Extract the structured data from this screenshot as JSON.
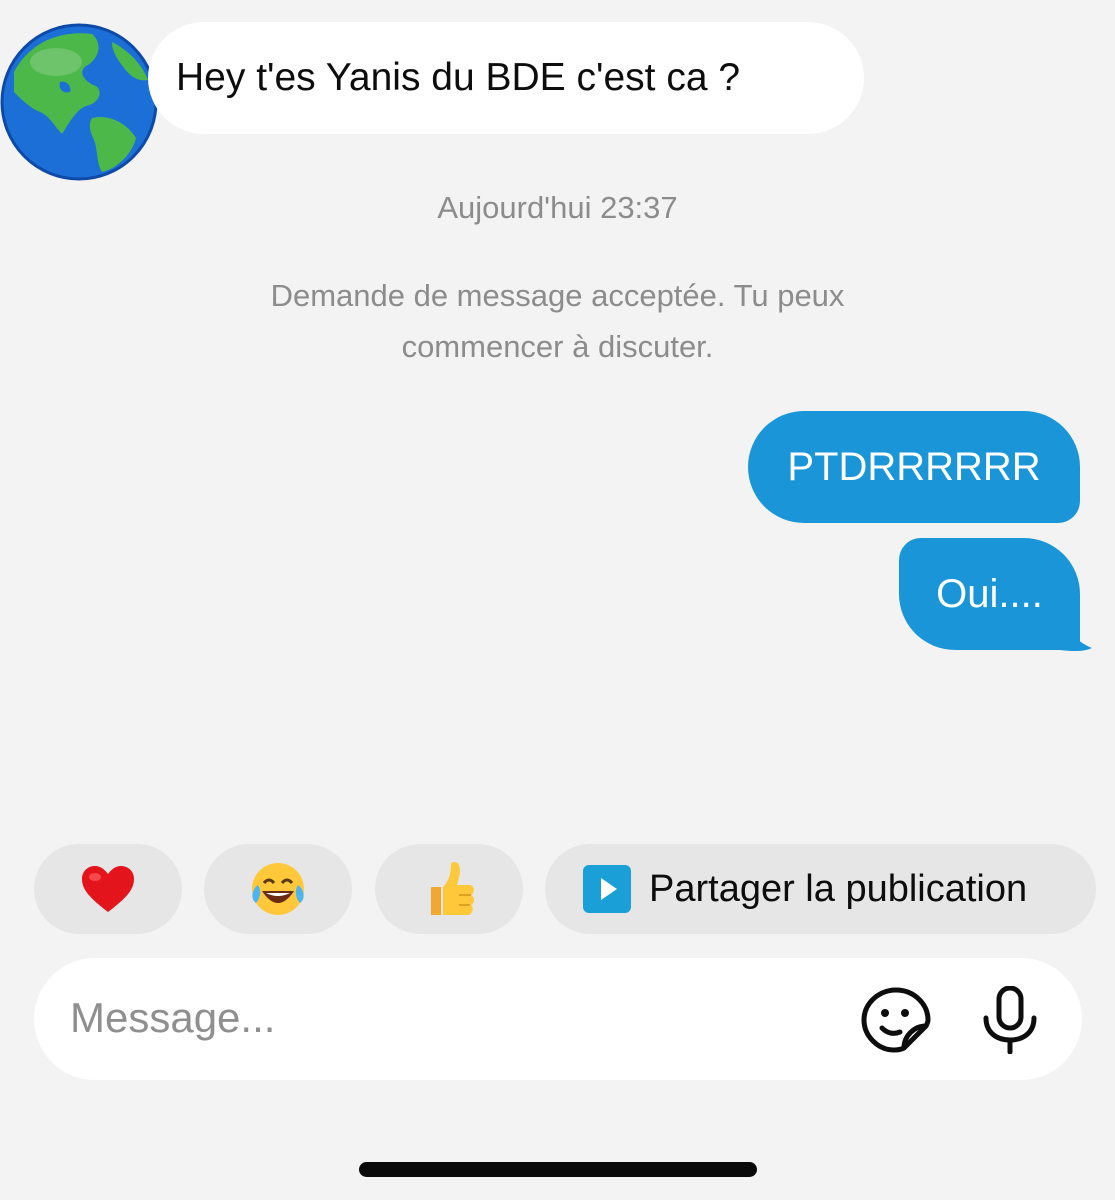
{
  "conversation": {
    "incoming_message": "Hey t'es Yanis du BDE c'est ca ?",
    "timestamp": "Aujourd'hui 23:37",
    "system_note_line1": "Demande de message acceptée. Tu peux",
    "system_note_line2": "commencer à discuter.",
    "outgoing_messages": [
      "PTDRRRRRR",
      "Oui...."
    ]
  },
  "quick_replies": {
    "reactions": [
      {
        "icon": "red-heart-icon",
        "glyph": "❤️"
      },
      {
        "icon": "face-with-tears-of-joy-icon",
        "glyph": "😂"
      },
      {
        "icon": "thumbs-up-icon",
        "glyph": "👍"
      }
    ],
    "share_label": "Partager la publication",
    "share_icon": "play-icon"
  },
  "composer": {
    "placeholder": "Message...",
    "sticker_icon": "sticker-icon",
    "mic_icon": "microphone-icon"
  },
  "colors": {
    "background": "#f3f3f3",
    "outgoing_bubble": "#1a96d8",
    "incoming_bubble": "#ffffff",
    "chip": "#e6e6e6",
    "muted_text": "#8c8c8c"
  }
}
